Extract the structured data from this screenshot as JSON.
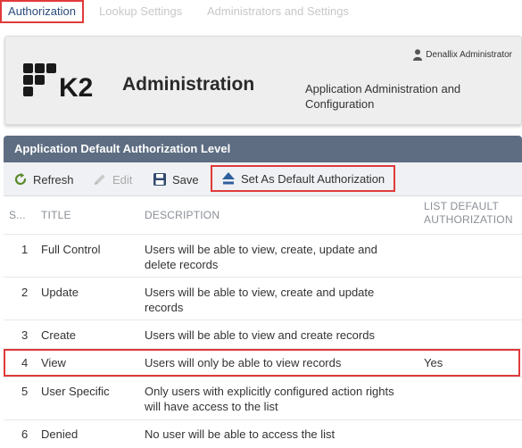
{
  "tabs": [
    {
      "label": "Authorization"
    },
    {
      "label": "Lookup Settings"
    },
    {
      "label": "Administrators and Settings"
    }
  ],
  "header": {
    "logo_text": "K2",
    "title": "Administration",
    "description": "Application Administration and Configuration",
    "user_name": "Denallix Administrator"
  },
  "panel": {
    "title": "Application Default Authorization Level"
  },
  "toolbar": {
    "refresh_label": "Refresh",
    "edit_label": "Edit",
    "save_label": "Save",
    "set_default_label": "Set As Default Authorization"
  },
  "table": {
    "columns": [
      "S...",
      "TITLE",
      "DESCRIPTION",
      "LIST DEFAULT AUTHORIZATION"
    ],
    "rows": [
      {
        "s": "1",
        "title": "Full Control",
        "description": "Users will be able to view, create, update and delete records",
        "list_default": ""
      },
      {
        "s": "2",
        "title": "Update",
        "description": "Users will be able to view, create and update records",
        "list_default": ""
      },
      {
        "s": "3",
        "title": "Create",
        "description": "Users will be able to view and create records",
        "list_default": ""
      },
      {
        "s": "4",
        "title": "View",
        "description": "Users will only be able to view records",
        "list_default": "Yes"
      },
      {
        "s": "5",
        "title": "User Specific",
        "description": "Only users with explicitly configured action rights will have access to the list",
        "list_default": ""
      },
      {
        "s": "6",
        "title": "Denied",
        "description": "No user will be able to access the list",
        "list_default": ""
      }
    ]
  },
  "colors": {
    "highlight": "#e03a3a",
    "panel_header": "#5e6d82",
    "toolbar_bg": "#eff1f4"
  }
}
